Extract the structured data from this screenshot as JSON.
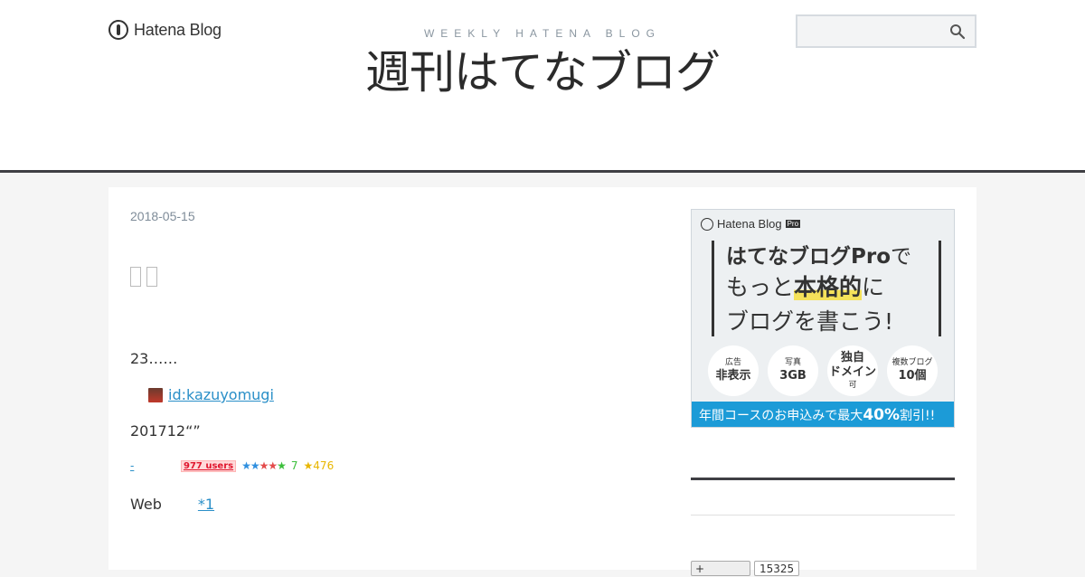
{
  "header": {
    "logo_text": "Hatena Blog",
    "blog_description": "WEEKLY HATENA BLOG",
    "blog_title": "週刊はてなブログ",
    "search_value": ""
  },
  "entry": {
    "date": "2018-05-15",
    "paragraph1": "23……",
    "author_id": "id:kazuyomugi",
    "paragraph2": "201712“”",
    "bookmark_link": "-",
    "bookmark_users": "977 users",
    "star_count_green": "7",
    "star_count_yellow": "476",
    "paragraph3": "Web",
    "footnote": "*1"
  },
  "sidebar": {
    "ad": {
      "logo_text": "Hatena Blog",
      "logo_badge": "Pro",
      "line1_bold": "はてなブログPro",
      "line1_rest": "で",
      "line2_pre": "もっと",
      "line2_bold": "本格的",
      "line2_post": "に",
      "line3": "ブログを書こう!",
      "features": [
        {
          "top": "広告",
          "bottom": "非表示"
        },
        {
          "top": "写真",
          "bottom": "3GB"
        },
        {
          "top": "独自",
          "bottom": "ドメイン",
          "sub": "可"
        },
        {
          "top": "複数ブログ",
          "bottom": "10個"
        }
      ],
      "banner_pre": "年間コースのお申込みで最大",
      "banner_bold": "40%",
      "banner_post": "割引!!"
    },
    "subscribe_label": "+",
    "subscribe_count": "15325"
  },
  "colors": {
    "accent_link": "#2a8fc8",
    "header_border": "#3f3f44",
    "ad_banner": "#1c9bd7"
  }
}
